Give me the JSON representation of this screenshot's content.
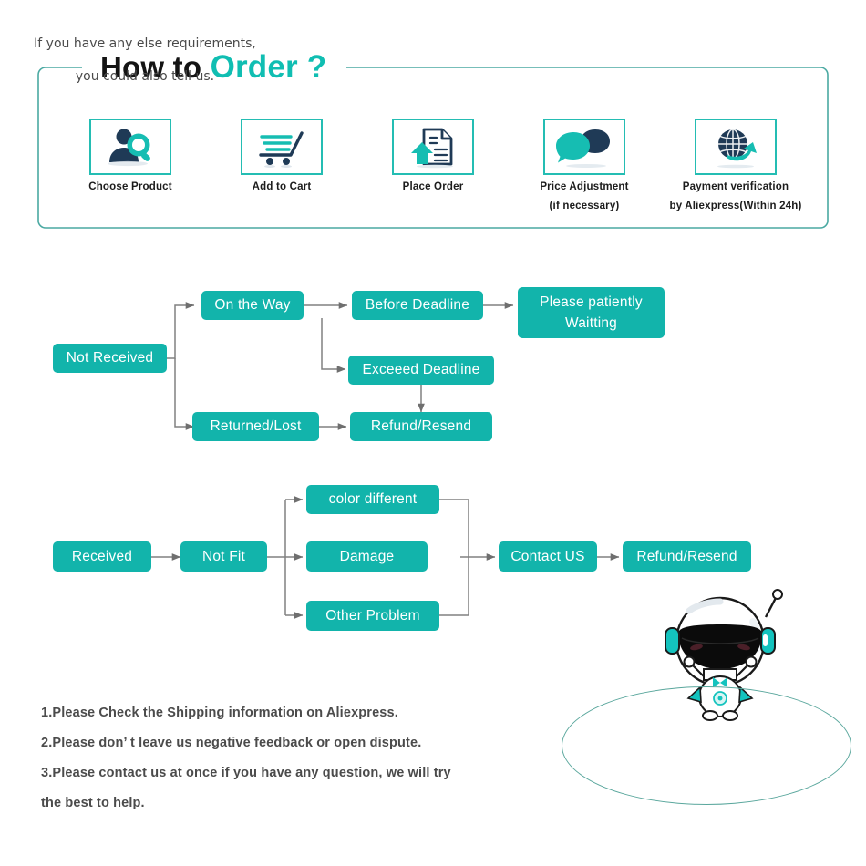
{
  "header": {
    "title_part1": "How to",
    "title_part2": "Order ?"
  },
  "steps": [
    {
      "icon": "person-search-icon",
      "label": "Choose  Product",
      "label2": ""
    },
    {
      "icon": "shopping-cart-icon",
      "label": "Add to Cart",
      "label2": ""
    },
    {
      "icon": "document-upload-icon",
      "label": "Place  Order",
      "label2": ""
    },
    {
      "icon": "speech-bubbles-icon",
      "label": "Price Adjustment",
      "label2": "(if necessary)"
    },
    {
      "icon": "globe-arrow-icon",
      "label": "Payment verification",
      "label2": "by Aliexpress(Within 24h)"
    }
  ],
  "flow_not_received": {
    "start": "Not Received",
    "on_the_way": "On the Way",
    "before_deadline": "Before Deadline",
    "please_wait": "Please patiently\nWaitting",
    "please_wait_line1": "Please patiently",
    "please_wait_line2": "Waitting",
    "exceed_deadline": "Exceeed Deadline",
    "returned_lost": "Returned/Lost",
    "refund_resend": "Refund/Resend"
  },
  "flow_received": {
    "start": "Received",
    "not_fit": "Not Fit",
    "reason_1": "color different",
    "reason_2": "Damage",
    "reason_3": "Other Problem",
    "contact_us": "Contact US",
    "refund_resend": "Refund/Resend"
  },
  "notes": [
    "1.Please Check the Shipping information on Aliexpress.",
    "2.Please don’  t leave us negative feedback or open dispute.",
    "3.Please contact us at once if you have any question, we will try",
    " the best to help."
  ],
  "speech": {
    "line1": "If you have any else requirements,",
    "line2": "you could also tell us."
  },
  "colors": {
    "teal": "#12B4AB",
    "teal_bright": "#10BEB2",
    "navy": "#1F3A56",
    "connector": "#808080",
    "frame": "#4AA9A2"
  }
}
